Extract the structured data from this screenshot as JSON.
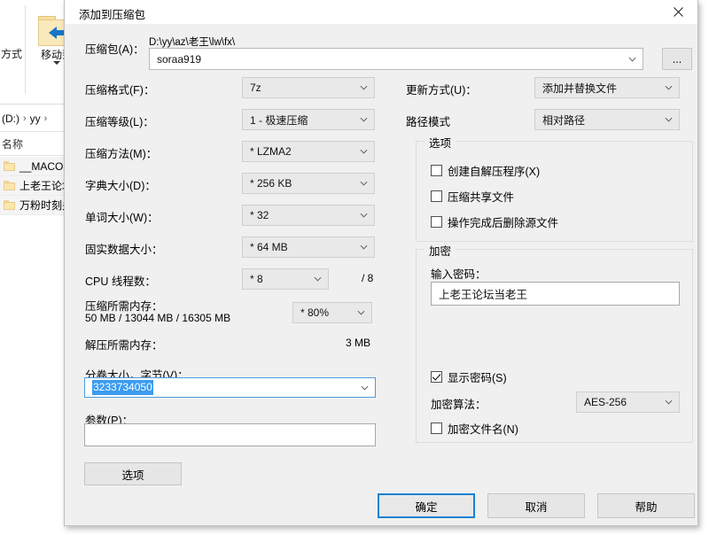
{
  "explorer": {
    "ribbon": {
      "left_partial_label": "方式",
      "move_to_label": "移动到",
      "move_to_icon": "folder-left-arrow-icon"
    },
    "breadcrumb": [
      "(D:)",
      "yy",
      ""
    ],
    "column_header": "名称",
    "files": [
      {
        "name": "__MACOS",
        "icon": "folder-icon"
      },
      {
        "name": "上老王论坛",
        "icon": "folder-icon"
      },
      {
        "name": "万粉时刻关",
        "icon": "folder-icon"
      }
    ]
  },
  "dialog": {
    "title": "添加到压缩包",
    "close_icon": "close-icon",
    "archive": {
      "label": "压缩包(A)：",
      "path": "D:\\yy\\az\\老王\\lw\\fx\\",
      "name_value": "soraa919",
      "browse_label": "..."
    },
    "left_fields": [
      {
        "label": "压缩格式(F)：",
        "value": "7z"
      },
      {
        "label": "压缩等级(L)：",
        "value": "1 - 极速压缩"
      },
      {
        "label": "压缩方法(M)：",
        "value": "* LZMA2"
      },
      {
        "label": "字典大小(D)：",
        "value": "* 256 KB"
      },
      {
        "label": "单词大小(W)：",
        "value": "* 32"
      },
      {
        "label": "固实数据大小：",
        "value": "* 64 MB"
      }
    ],
    "cpu": {
      "label": "CPU 线程数：",
      "value": "* 8",
      "total": "/ 8"
    },
    "memory": {
      "compress_label": "压缩所需内存：",
      "compress_values": "50 MB / 13044 MB / 16305 MB",
      "percent_value": "* 80%",
      "decompress_label": "解压所需内存：",
      "decompress_value": "3 MB"
    },
    "volume": {
      "label": "分卷大小，字节(V)：",
      "value": "3233734050"
    },
    "params": {
      "label": "参数(P)：",
      "value": ""
    },
    "options_button": "选项",
    "update_mode": {
      "label": "更新方式(U)：",
      "value": "添加并替换文件"
    },
    "path_mode": {
      "label": "路径模式",
      "value": "相对路径"
    },
    "options_group": {
      "title": "选项",
      "checkboxes": [
        {
          "label": "创建自解压程序(X)",
          "checked": false
        },
        {
          "label": "压缩共享文件",
          "checked": false
        },
        {
          "label": "操作完成后删除源文件",
          "checked": false
        }
      ]
    },
    "encryption_group": {
      "title": "加密",
      "password_label": "输入密码：",
      "password_value": "上老王论坛当老王",
      "show_password": {
        "label": "显示密码(S)",
        "checked": true
      },
      "algorithm_label": "加密算法：",
      "algorithm_value": "AES-256",
      "encrypt_filenames": {
        "label": "加密文件名(N)",
        "checked": false
      }
    },
    "buttons": {
      "ok": "确定",
      "cancel": "取消",
      "help": "帮助"
    }
  },
  "colors": {
    "accent": "#1b82d2",
    "selection": "#3b9cf0",
    "dialog_bg": "#f0f0f0",
    "combo_bg": "#e9e9e9"
  }
}
